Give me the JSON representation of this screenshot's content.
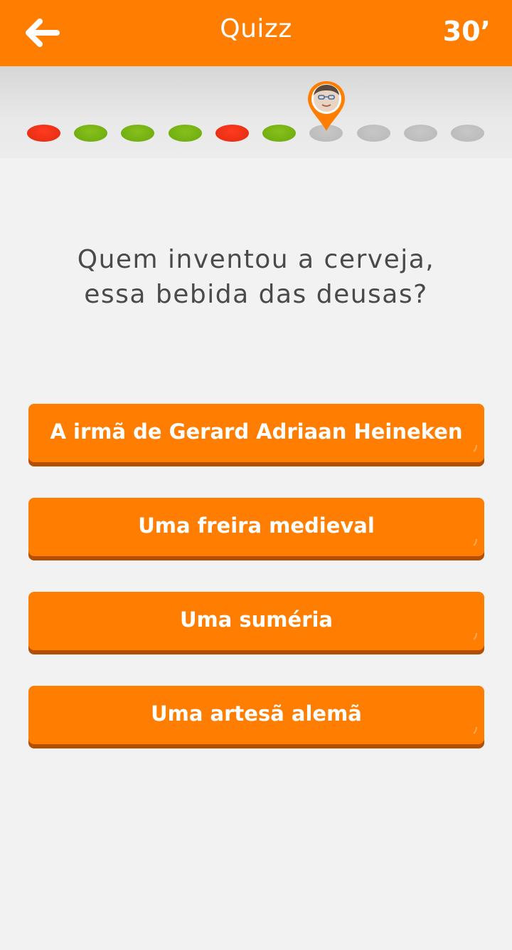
{
  "header": {
    "title": "Quizz",
    "timer": "30’",
    "back_icon": "arrow-left-icon"
  },
  "progress": {
    "dots": [
      "red",
      "green",
      "green",
      "green",
      "red",
      "green",
      "grey",
      "grey",
      "grey",
      "grey"
    ],
    "current_index": 6,
    "marker_icon": "avatar-location-pin-icon"
  },
  "question": {
    "line1": "Quem inventou a cerveja,",
    "line2": "essa bebida das deusas?"
  },
  "answers": [
    {
      "label": "A irmã de Gerard Adriaan Heineken"
    },
    {
      "label": "Uma freira medieval"
    },
    {
      "label": "Uma suméria"
    },
    {
      "label": "Uma artesã alemã"
    }
  ],
  "colors": {
    "accent": "#ff7d00",
    "correct": "#7ab515",
    "wrong": "#f2351a",
    "pending": "#c0c0c0"
  }
}
